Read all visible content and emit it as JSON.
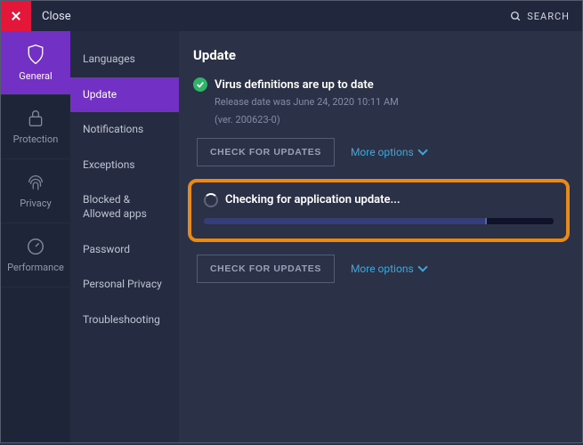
{
  "titlebar": {
    "close_label": "Close",
    "search_label": "SEARCH"
  },
  "nav_primary": {
    "items": [
      {
        "label": "General"
      },
      {
        "label": "Protection"
      },
      {
        "label": "Privacy"
      },
      {
        "label": "Performance"
      }
    ]
  },
  "nav_secondary": {
    "items": [
      {
        "label": "Languages"
      },
      {
        "label": "Update"
      },
      {
        "label": "Notifications"
      },
      {
        "label": "Exceptions"
      },
      {
        "label": "Blocked & Allowed apps"
      },
      {
        "label": "Password"
      },
      {
        "label": "Personal Privacy"
      },
      {
        "label": "Troubleshooting"
      }
    ]
  },
  "main": {
    "heading": "Update",
    "virus": {
      "title": "Virus definitions are up to date",
      "release_line": "Release date was June 24, 2020 10:11 AM",
      "version_line": "(ver. 200623-0)",
      "check_btn": "CHECK FOR UPDATES",
      "more": "More options"
    },
    "app": {
      "title": "Checking for application update...",
      "progress_percent": 81,
      "check_btn": "CHECK FOR UPDATES",
      "more": "More options"
    }
  }
}
